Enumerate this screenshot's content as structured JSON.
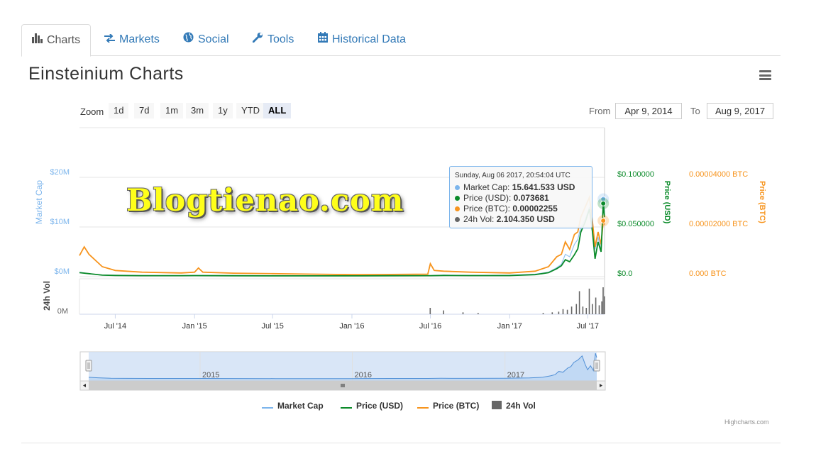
{
  "tabs": [
    {
      "label": "Charts",
      "icon": "bar-chart-icon",
      "active": true
    },
    {
      "label": "Markets",
      "icon": "exchange-arrows-icon",
      "active": false
    },
    {
      "label": "Social",
      "icon": "globe-icon",
      "active": false
    },
    {
      "label": "Tools",
      "icon": "wrench-icon",
      "active": false
    },
    {
      "label": "Historical Data",
      "icon": "calendar-icon",
      "active": false
    }
  ],
  "title": "Einsteinium Charts",
  "zoom": {
    "label": "Zoom",
    "buttons": [
      "1d",
      "7d",
      "1m",
      "3m",
      "1y",
      "YTD",
      "ALL"
    ],
    "selected": "ALL"
  },
  "range": {
    "from_label": "From",
    "from_value": "Apr 9, 2014",
    "to_label": "To",
    "to_value": "Aug 9, 2017"
  },
  "watermark": "Blogtienao.com",
  "tooltip": {
    "date": "Sunday, Aug 06 2017, 20:54:04 UTC",
    "rows": [
      {
        "label": "Market Cap: ",
        "value": "15.641.533 USD",
        "color": "#7cb5ec"
      },
      {
        "label": "Price (USD): ",
        "value": "0.073681",
        "color": "#0a8a29"
      },
      {
        "label": "Price (BTC): ",
        "value": "0.00002255",
        "color": "#f7941d"
      },
      {
        "label": "24h Vol: ",
        "value": "2.104.350 USD",
        "color": "#666666"
      }
    ]
  },
  "legend": [
    {
      "label": "Market Cap",
      "color": "#7cb5ec",
      "shape": "line"
    },
    {
      "label": "Price (USD)",
      "color": "#0a8a29",
      "shape": "line"
    },
    {
      "label": "Price (BTC)",
      "color": "#f7941d",
      "shape": "line"
    },
    {
      "label": "24h Vol",
      "color": "#666666",
      "shape": "square"
    }
  ],
  "credit": "Highcharts.com",
  "chart_data": {
    "type": "line",
    "title": "Einsteinium Charts",
    "x_range": [
      "2014-04-09",
      "2017-08-09"
    ],
    "x_ticks": [
      "Jul '14",
      "Jan '15",
      "Jul '15",
      "Jan '16",
      "Jul '16",
      "Jan '17",
      "Jul '17"
    ],
    "x_tick_dates": [
      "2014-07-01",
      "2015-01-01",
      "2015-07-01",
      "2016-01-01",
      "2016-07-01",
      "2017-01-01",
      "2017-07-01"
    ],
    "axes": {
      "market_cap": {
        "label": "Market Cap",
        "ticks": [
          "$0M",
          "$10M",
          "$20M"
        ],
        "range": [
          0,
          20000000
        ],
        "color": "#7cb5ec"
      },
      "price_usd": {
        "label": "Price (USD)",
        "ticks": [
          "$0.0",
          "$0.050000",
          "$0.100000"
        ],
        "range": [
          0,
          0.1
        ],
        "color": "#0a8a29"
      },
      "price_btc": {
        "label": "Price (BTC)",
        "ticks": [
          "0.000 BTC",
          "0.00002000 BTC",
          "0.00004000 BTC"
        ],
        "range": [
          0,
          4e-05
        ],
        "color": "#f7941d"
      },
      "volume": {
        "label": "24h Vol",
        "ticks": [
          "0M"
        ],
        "color": "#666666"
      }
    },
    "grid": true,
    "legend_position": "bottom-center",
    "navigator_ticks": [
      "2015",
      "2016",
      "2017"
    ],
    "series": [
      {
        "name": "Market Cap",
        "color": "#7cb5ec",
        "x": [
          "2014-04-09",
          "2014-05-01",
          "2014-06-01",
          "2014-07-01",
          "2014-09-01",
          "2014-12-01",
          "2015-01-01",
          "2015-04-01",
          "2015-07-01",
          "2015-10-01",
          "2016-01-01",
          "2016-04-01",
          "2016-07-01",
          "2016-08-01",
          "2016-10-01",
          "2017-01-01",
          "2017-03-01",
          "2017-04-01",
          "2017-04-20",
          "2017-05-01",
          "2017-05-10",
          "2017-05-20",
          "2017-05-31",
          "2017-06-08",
          "2017-06-15",
          "2017-06-25",
          "2017-07-05",
          "2017-07-12",
          "2017-07-18",
          "2017-07-25",
          "2017-08-01",
          "2017-08-06",
          "2017-08-09"
        ],
        "values": [
          900000,
          600000,
          300000,
          250000,
          220000,
          200000,
          220000,
          180000,
          150000,
          150000,
          150000,
          200000,
          200000,
          300000,
          250000,
          300000,
          500000,
          900000,
          1800000,
          2500000,
          4500000,
          4000000,
          6500000,
          7500000,
          10000000,
          11500000,
          14000000,
          9000000,
          5500000,
          8000000,
          5000000,
          15641533,
          13000000
        ]
      },
      {
        "name": "Price (USD)",
        "color": "#0a8a29",
        "x": [
          "2014-04-09",
          "2014-05-01",
          "2014-06-01",
          "2014-07-01",
          "2014-09-01",
          "2014-12-01",
          "2015-01-01",
          "2015-04-01",
          "2015-07-01",
          "2015-10-01",
          "2016-01-01",
          "2016-04-01",
          "2016-07-01",
          "2016-08-01",
          "2016-10-01",
          "2017-01-01",
          "2017-03-01",
          "2017-04-01",
          "2017-04-20",
          "2017-05-01",
          "2017-05-10",
          "2017-05-20",
          "2017-05-31",
          "2017-06-08",
          "2017-06-15",
          "2017-06-25",
          "2017-07-05",
          "2017-07-12",
          "2017-07-18",
          "2017-07-25",
          "2017-08-01",
          "2017-08-06",
          "2017-08-09"
        ],
        "values": [
          0.004,
          0.003,
          0.0015,
          0.0012,
          0.001,
          0.001,
          0.0011,
          0.0009,
          0.0008,
          0.0008,
          0.0008,
          0.0009,
          0.001,
          0.0012,
          0.0011,
          0.0011,
          0.002,
          0.004,
          0.008,
          0.011,
          0.017,
          0.015,
          0.022,
          0.028,
          0.045,
          0.055,
          0.068,
          0.045,
          0.018,
          0.035,
          0.025,
          0.073681,
          0.06
        ]
      },
      {
        "name": "Price (BTC)",
        "color": "#f7941d",
        "x": [
          "2014-04-09",
          "2014-04-20",
          "2014-05-01",
          "2014-06-01",
          "2014-07-01",
          "2014-09-01",
          "2014-12-01",
          "2015-01-01",
          "2015-01-10",
          "2015-01-20",
          "2015-04-01",
          "2015-07-01",
          "2015-10-01",
          "2016-01-01",
          "2016-04-01",
          "2016-06-25",
          "2016-07-01",
          "2016-07-10",
          "2016-08-01",
          "2016-10-01",
          "2017-01-01",
          "2017-03-01",
          "2017-04-01",
          "2017-04-20",
          "2017-05-01",
          "2017-05-10",
          "2017-05-20",
          "2017-05-31",
          "2017-06-08",
          "2017-06-15",
          "2017-06-25",
          "2017-07-05",
          "2017-07-12",
          "2017-07-18",
          "2017-07-25",
          "2017-08-01",
          "2017-08-06",
          "2017-08-09"
        ],
        "values": [
          8.5e-06,
          1.2e-05,
          9e-06,
          4e-06,
          2.5e-06,
          1.8e-06,
          1.5e-06,
          1.8e-06,
          3.5e-06,
          1.8e-06,
          1.4e-06,
          1.2e-06,
          1e-06,
          8e-07,
          9e-07,
          1e-06,
          5.2e-06,
          2.5e-06,
          2.2e-06,
          1.8e-06,
          1.5e-06,
          2.2e-06,
          4e-06,
          8e-06,
          9e-06,
          1.4e-05,
          1.1e-05,
          1.7e-05,
          1.8e-05,
          2.4e-05,
          2.8e-05,
          3.2e-05,
          2.2e-05,
          1.2e-05,
          1.8e-05,
          1.3e-05,
          2.255e-05,
          2.1e-05
        ]
      },
      {
        "name": "24h Vol",
        "color": "#666666",
        "type": "column",
        "x": [
          "2016-07-01",
          "2016-08-01",
          "2016-09-15",
          "2016-10-20",
          "2017-03-20",
          "2017-04-10",
          "2017-04-25",
          "2017-05-05",
          "2017-05-15",
          "2017-05-25",
          "2017-06-05",
          "2017-06-12",
          "2017-06-20",
          "2017-06-28",
          "2017-07-05",
          "2017-07-12",
          "2017-07-20",
          "2017-07-28",
          "2017-08-03",
          "2017-08-06",
          "2017-08-09"
        ],
        "values": [
          500000,
          300000,
          150000,
          100000,
          100000,
          150000,
          200000,
          400000,
          350000,
          600000,
          800000,
          1800000,
          600000,
          500000,
          2000000,
          800000,
          1300000,
          700000,
          1000000,
          2104350,
          1400000
        ]
      }
    ]
  }
}
